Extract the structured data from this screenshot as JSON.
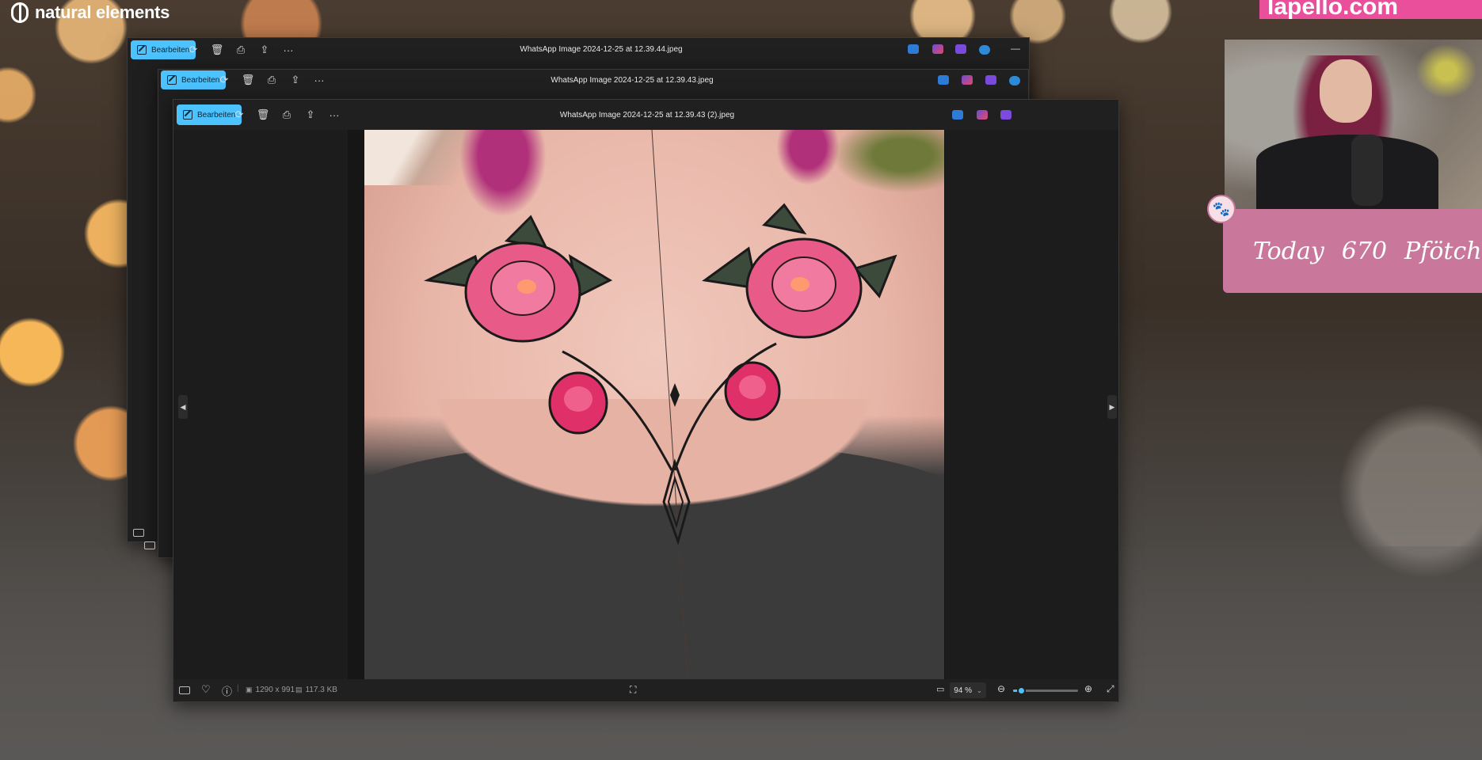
{
  "overlay": {
    "brand": "natural elements",
    "top_banner": "lapello.com",
    "counter": {
      "label": "Today",
      "count": "670",
      "unit": "Pfötchen"
    }
  },
  "windows": {
    "back": {
      "edit_label": "Bearbeiten",
      "title": "WhatsApp Image 2024-12-25 at 12.39.44.jpeg",
      "minimize": "—"
    },
    "middle": {
      "edit_label": "Bearbeiten",
      "title": "WhatsApp Image 2024-12-25 at 12.39.43.jpeg"
    },
    "front": {
      "edit_label": "Bearbeiten",
      "title": "WhatsApp Image 2024-12-25 at 12.39.43 (2).jpeg",
      "status": {
        "dimensions": "1290 x 991",
        "file_size": "117.3 KB",
        "zoom": "94 %",
        "zoom_level": 0.12
      }
    }
  },
  "icons": {
    "rotate": "rotate-icon",
    "delete": "trash-icon",
    "print": "print-icon",
    "share": "share-icon",
    "more": "more-icon",
    "filmstrip": "filmstrip-icon",
    "favorite": "heart-icon",
    "info": "info-icon",
    "fit": "fit-to-screen-icon",
    "zoom_out": "zoom-out-icon",
    "zoom_in": "zoom-in-icon",
    "fullscreen": "fullscreen-icon"
  },
  "colors": {
    "accent": "#4cc2ff",
    "counter_bg": "#c9779a",
    "banner_bg": "#e94f9a"
  }
}
